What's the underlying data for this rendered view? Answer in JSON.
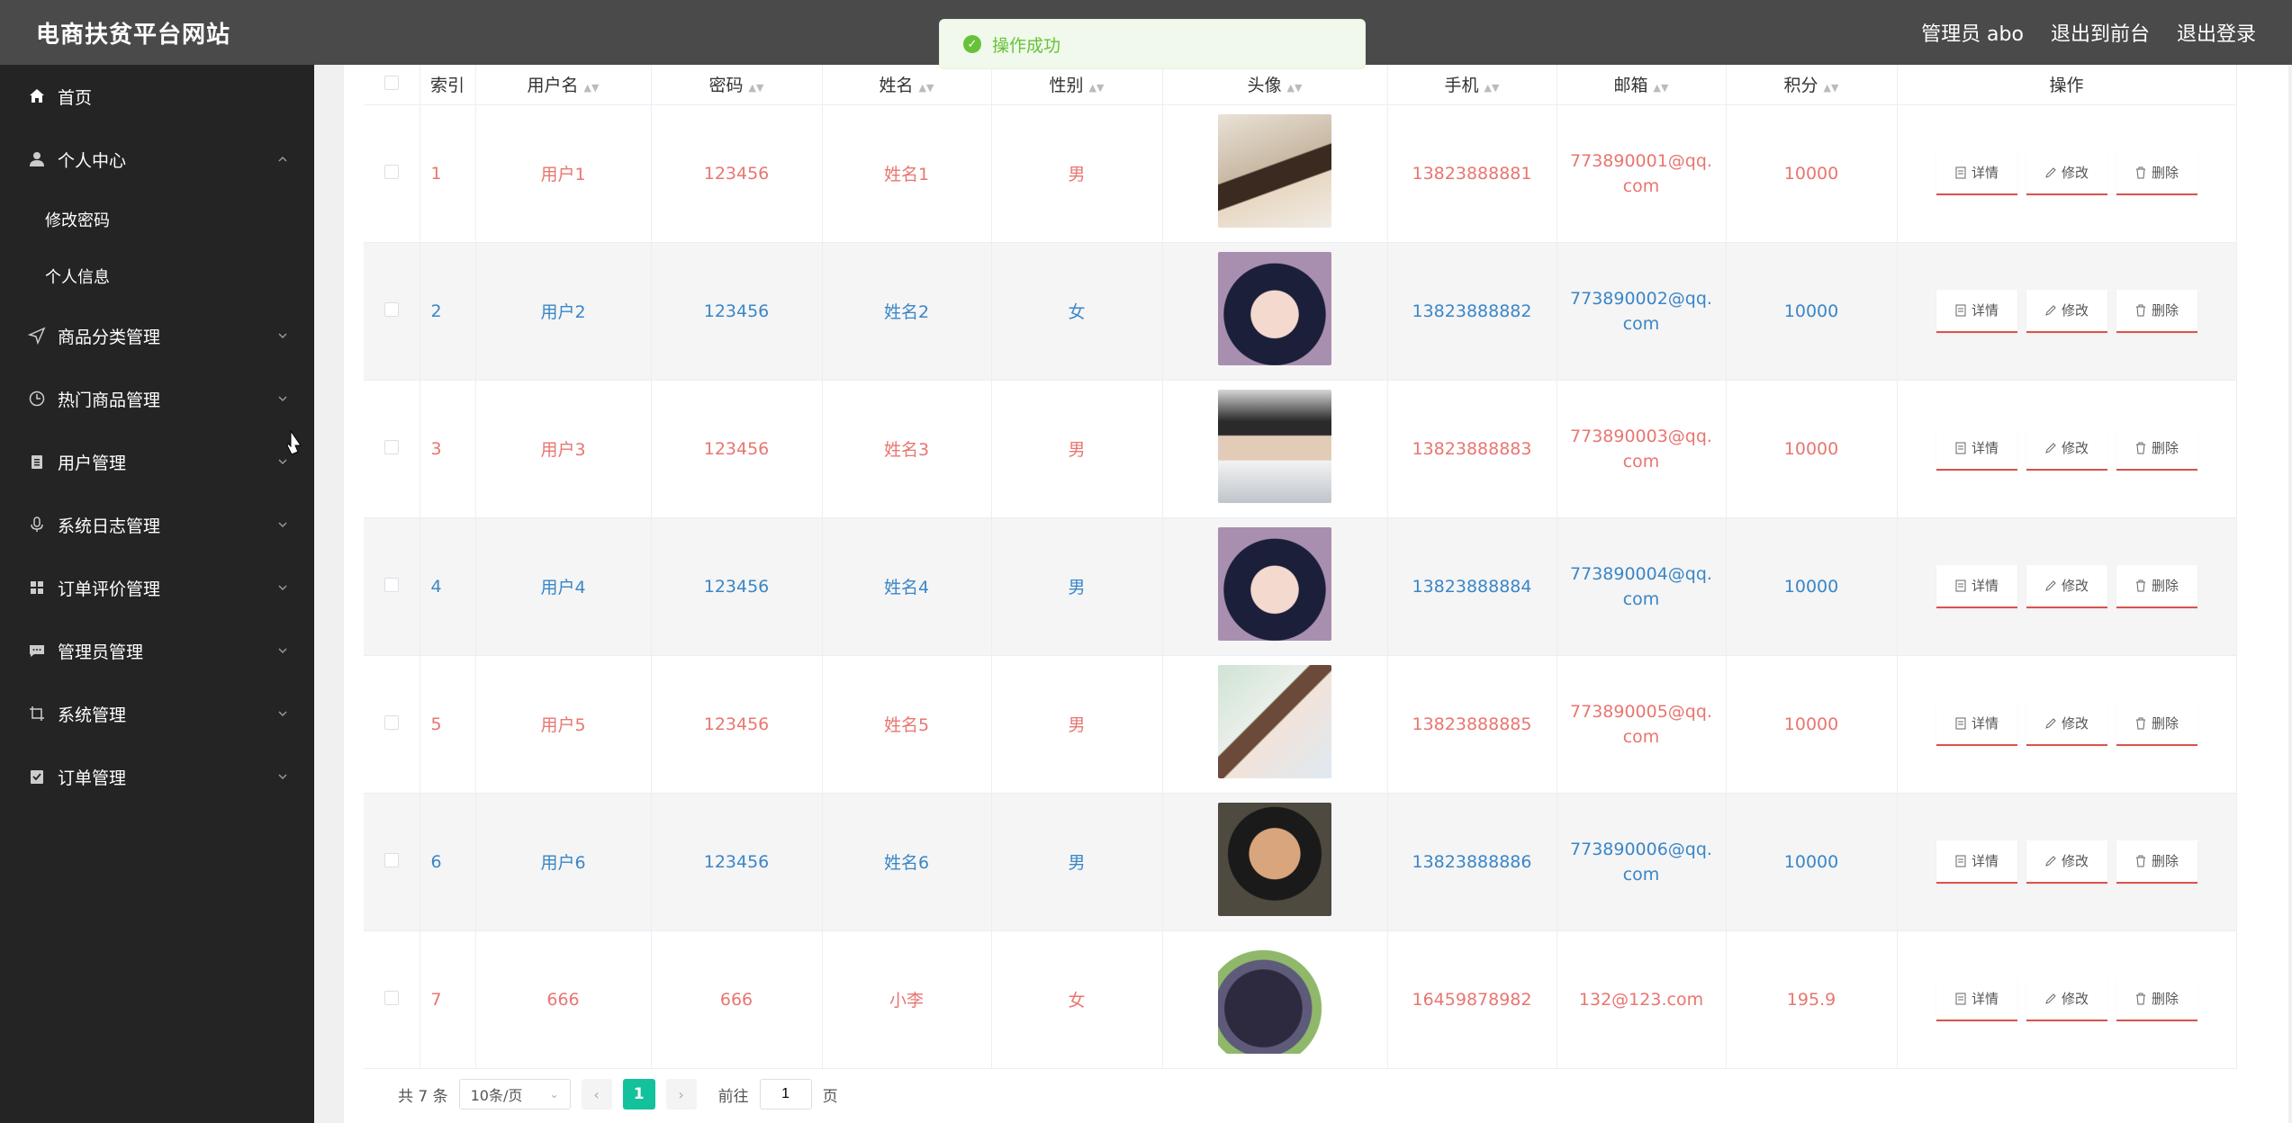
{
  "app": {
    "title": "电商扶贫平台网站"
  },
  "topnav": {
    "admin": "管理员 abo",
    "to_front": "退出到前台",
    "logout": "退出登录"
  },
  "toast": {
    "message": "操作成功"
  },
  "sidebar": {
    "items": [
      {
        "label": "首页",
        "icon": "home-icon",
        "expanded": false,
        "has_children": false
      },
      {
        "label": "个人中心",
        "icon": "user-icon",
        "expanded": true,
        "has_children": true,
        "children": [
          "修改密码",
          "个人信息"
        ]
      },
      {
        "label": "商品分类管理",
        "icon": "send-icon",
        "has_children": true
      },
      {
        "label": "热门商品管理",
        "icon": "clock-icon",
        "has_children": true
      },
      {
        "label": "用户管理",
        "icon": "clipboard-icon",
        "has_children": true
      },
      {
        "label": "系统日志管理",
        "icon": "microphone-icon",
        "has_children": true
      },
      {
        "label": "订单评价管理",
        "icon": "grid-icon",
        "has_children": true
      },
      {
        "label": "管理员管理",
        "icon": "chat-icon",
        "has_children": true
      },
      {
        "label": "系统管理",
        "icon": "crop-icon",
        "has_children": true
      },
      {
        "label": "订单管理",
        "icon": "checklist-icon",
        "has_children": true
      }
    ]
  },
  "table": {
    "headers": [
      "索引",
      "用户名",
      "密码",
      "姓名",
      "性别",
      "头像",
      "手机",
      "邮箱",
      "积分",
      "操作"
    ],
    "actions": {
      "detail": "详情",
      "edit": "修改",
      "delete": "删除"
    },
    "rows": [
      {
        "index": "1",
        "username": "用户1",
        "password": "123456",
        "name": "姓名1",
        "gender": "男",
        "phone": "13823888881",
        "email": "773890001@qq.com",
        "points": "10000",
        "avatar": "young man making peace sign"
      },
      {
        "index": "2",
        "username": "用户2",
        "password": "123456",
        "name": "姓名2",
        "gender": "女",
        "phone": "13823888882",
        "email": "773890002@qq.com",
        "points": "10000",
        "avatar": "young woman with dark hair"
      },
      {
        "index": "3",
        "username": "用户3",
        "password": "123456",
        "name": "姓名3",
        "gender": "男",
        "phone": "13823888883",
        "email": "773890003@qq.com",
        "points": "10000",
        "avatar": "young man in white shirt"
      },
      {
        "index": "4",
        "username": "用户4",
        "password": "123456",
        "name": "姓名4",
        "gender": "男",
        "phone": "13823888884",
        "email": "773890004@qq.com",
        "points": "10000",
        "avatar": "young woman with dark hair"
      },
      {
        "index": "5",
        "username": "用户5",
        "password": "123456",
        "name": "姓名5",
        "gender": "男",
        "phone": "13823888885",
        "email": "773890005@qq.com",
        "points": "10000",
        "avatar": "woman with ponytail outdoors"
      },
      {
        "index": "6",
        "username": "用户6",
        "password": "123456",
        "name": "姓名6",
        "gender": "男",
        "phone": "13823888886",
        "email": "773890006@qq.com",
        "points": "10000",
        "avatar": "man making funny face"
      },
      {
        "index": "7",
        "username": "666",
        "password": "666",
        "name": "小李",
        "gender": "女",
        "phone": "16459878982",
        "email": "132@123.com",
        "points": "195.9",
        "avatar": "bunch of dark grapes"
      }
    ]
  },
  "pagination": {
    "total": "共 7 条",
    "page_size": "10条/页",
    "current": "1",
    "goto": "前往",
    "goto_value": "1",
    "page_unit": "页"
  },
  "colors": {
    "topbar": "#4a4a4a",
    "sidebar": "#242424",
    "accent": "#13c29c",
    "row_red": "#e87670",
    "row_blue": "#3a86c8",
    "toast_green": "#67c23a"
  }
}
